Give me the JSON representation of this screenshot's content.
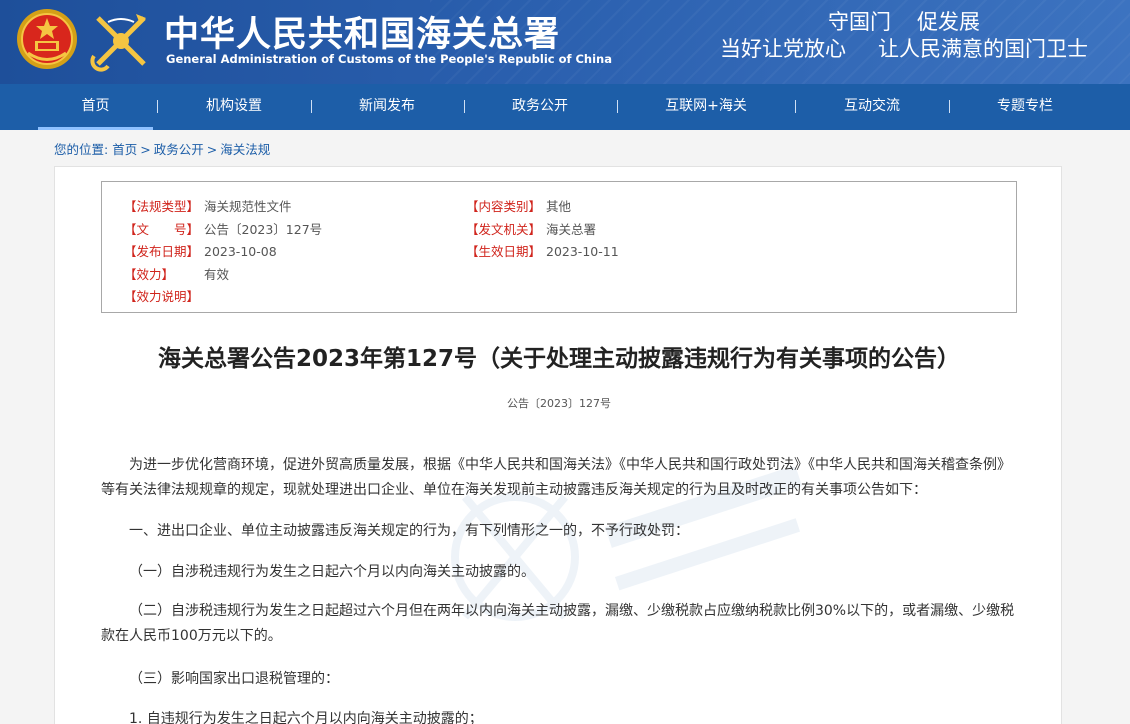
{
  "header": {
    "title": "中华人民共和国海关总署",
    "subtitle": "General Administration of Customs of the People's Republic of China",
    "slogan_line1": [
      "守国门",
      "促发展"
    ],
    "slogan_line2": [
      "当好让党放心",
      "让人民满意的国门卫士"
    ]
  },
  "nav": {
    "items": [
      {
        "label": "首页",
        "active": true
      },
      {
        "label": "机构设置"
      },
      {
        "label": "新闻发布"
      },
      {
        "label": "政务公开"
      },
      {
        "label": "互联网+海关"
      },
      {
        "label": "互动交流"
      },
      {
        "label": "专题专栏"
      }
    ]
  },
  "breadcrumb": {
    "prefix": "您的位置:",
    "items": [
      "首页",
      "政务公开",
      "海关法规"
    ]
  },
  "meta": {
    "left": [
      {
        "key": "【法规类型】",
        "value": "海关规范性文件"
      },
      {
        "key": "【文　　号】",
        "value": "公告〔2023〕127号"
      },
      {
        "key": "【发布日期】",
        "value": "2023-10-08"
      },
      {
        "key": "【效力】",
        "value": "有效"
      },
      {
        "key": "【效力说明】",
        "value": ""
      }
    ],
    "right": [
      {
        "key": "【内容类别】",
        "value": "其他"
      },
      {
        "key": "【发文机关】",
        "value": "海关总署"
      },
      {
        "key": "【生效日期】",
        "value": "2023-10-11"
      }
    ]
  },
  "document": {
    "title": "海关总署公告2023年第127号（关于处理主动披露违规行为有关事项的公告）",
    "number": "公告〔2023〕127号",
    "paragraphs": [
      "为进一步优化营商环境，促进外贸高质量发展，根据《中华人民共和国海关法》《中华人民共和国行政处罚法》《中华人民共和国海关稽查条例》等有关法律法规规章的规定，现就处理进出口企业、单位在海关发现前主动披露违反海关规定的行为且及时改正的有关事项公告如下：",
      "一、进出口企业、单位主动披露违反海关规定的行为，有下列情形之一的，不予行政处罚：",
      "（一）自涉税违规行为发生之日起六个月以内向海关主动披露的。",
      "（二）自涉税违规行为发生之日起超过六个月但在两年以内向海关主动披露，漏缴、少缴税款占应缴纳税款比例30%以下的，或者漏缴、少缴税款在人民币100万元以下的。",
      "（三）影响国家出口退税管理的：",
      "1. 自违规行为发生之日起六个月以内向海关主动披露的；"
    ]
  },
  "colors": {
    "header_bg": "#2a5fae",
    "nav_bg": "#1d5ea8",
    "meta_key": "#d0241c",
    "link": "#1d5ea8"
  }
}
